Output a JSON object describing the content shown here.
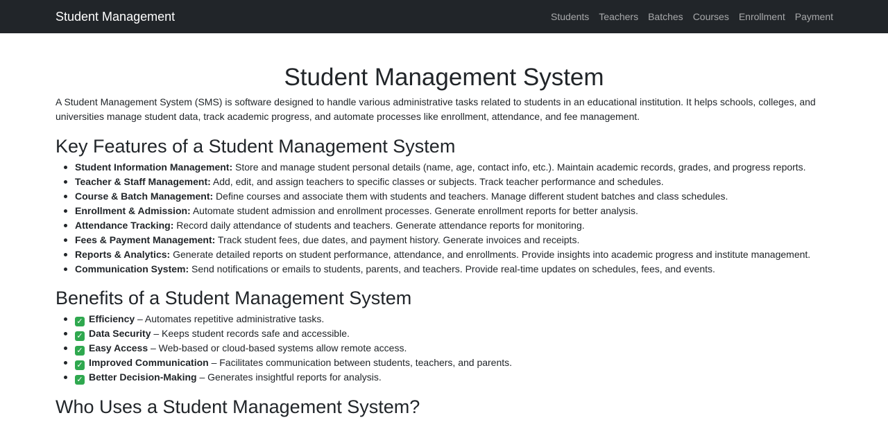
{
  "navbar": {
    "brand": "Student Management",
    "links": [
      "Students",
      "Teachers",
      "Batches",
      "Courses",
      "Enrollment",
      "Payment"
    ]
  },
  "main": {
    "title": "Student Management System",
    "intro": "A Student Management System (SMS) is software designed to handle various administrative tasks related to students in an educational institution. It helps schools, colleges, and universities manage student data, track academic progress, and automate processes like enrollment, attendance, and fee management.",
    "features": {
      "heading": "Key Features of a Student Management System",
      "items": [
        {
          "term": "Student Information Management:",
          "text": " Store and manage student personal details (name, age, contact info, etc.). Maintain academic records, grades, and progress reports."
        },
        {
          "term": "Teacher & Staff Management:",
          "text": " Add, edit, and assign teachers to specific classes or subjects. Track teacher performance and schedules."
        },
        {
          "term": "Course & Batch Management:",
          "text": " Define courses and associate them with students and teachers. Manage different student batches and class schedules."
        },
        {
          "term": "Enrollment & Admission:",
          "text": " Automate student admission and enrollment processes. Generate enrollment reports for better analysis."
        },
        {
          "term": "Attendance Tracking:",
          "text": " Record daily attendance of students and teachers. Generate attendance reports for monitoring."
        },
        {
          "term": "Fees & Payment Management:",
          "text": " Track student fees, due dates, and payment history. Generate invoices and receipts."
        },
        {
          "term": "Reports & Analytics:",
          "text": " Generate detailed reports on student performance, attendance, and enrollments. Provide insights into academic progress and institute management."
        },
        {
          "term": "Communication System:",
          "text": " Send notifications or emails to students, parents, and teachers. Provide real-time updates on schedules, fees, and events."
        }
      ]
    },
    "benefits": {
      "heading": "Benefits of a Student Management System",
      "check_glyph": "✓",
      "check_color": "#2fa84f",
      "items": [
        {
          "term": "Efficiency",
          "text": " – Automates repetitive administrative tasks."
        },
        {
          "term": "Data Security",
          "text": " – Keeps student records safe and accessible."
        },
        {
          "term": "Easy Access",
          "text": " – Web-based or cloud-based systems allow remote access."
        },
        {
          "term": "Improved Communication",
          "text": " – Facilitates communication between students, teachers, and parents."
        },
        {
          "term": "Better Decision-Making",
          "text": " – Generates insightful reports for analysis."
        }
      ]
    },
    "users": {
      "heading": "Who Uses a Student Management System?"
    }
  },
  "colors": {
    "navbar_bg": "#212529",
    "text": "#212529",
    "nav_link": "rgba(255,255,255,0.6)"
  }
}
